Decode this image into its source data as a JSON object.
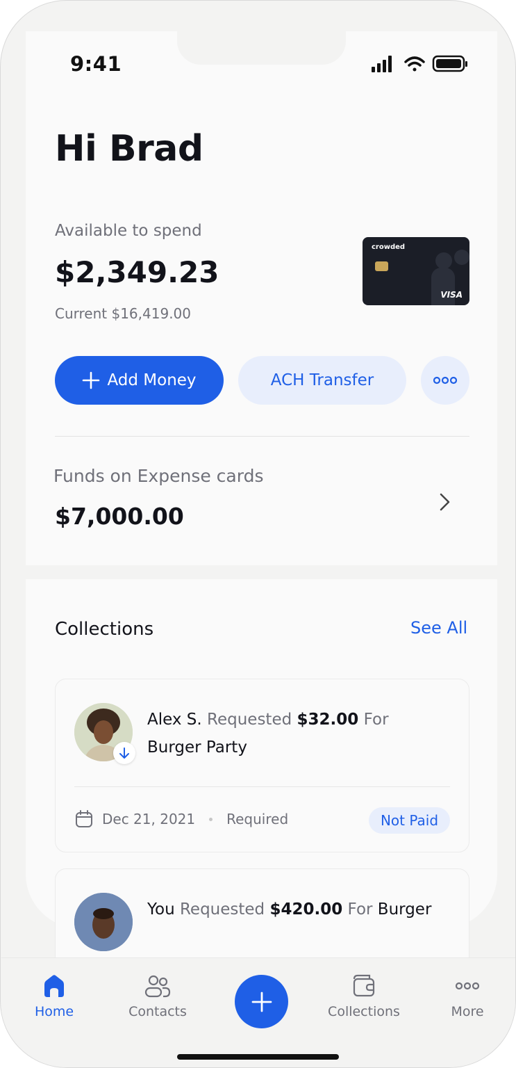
{
  "status": {
    "time": "9:41"
  },
  "greeting": "Hi Brad",
  "balance": {
    "available_label": "Available to spend",
    "available_amount": "$2,349.23",
    "current_label": "Current",
    "current_amount": "$16,419.00"
  },
  "card": {
    "brand_logo": "crowded",
    "network": "VISA"
  },
  "actions": {
    "add_money": "Add Money",
    "ach_transfer": "ACH Transfer",
    "more_icon": "ellipsis-icon"
  },
  "funds": {
    "label": "Funds on Expense cards",
    "amount": "$7,000.00"
  },
  "collections": {
    "title": "Collections",
    "see_all": "See All",
    "items": [
      {
        "name": "Alex S.",
        "verb": "Requested",
        "amount": "$32.00",
        "for_label": "For",
        "event": "Burger Party",
        "date": "Dec 21, 2021",
        "requirement": "Required",
        "status": "Not Paid"
      },
      {
        "name": "You",
        "verb": "Requested",
        "amount": "$420.00",
        "for_label": "For",
        "event": "Burger"
      }
    ]
  },
  "tabs": [
    {
      "label": "Home",
      "icon": "home-icon",
      "active": true
    },
    {
      "label": "Contacts",
      "icon": "contacts-icon",
      "active": false
    },
    {
      "label": "",
      "icon": "plus-icon",
      "active": false
    },
    {
      "label": "Collections",
      "icon": "wallet-icon",
      "active": false
    },
    {
      "label": "More",
      "icon": "ellipsis-icon",
      "active": false
    }
  ],
  "colors": {
    "accent": "#1f5fe6",
    "accent_soft": "#e8eefc",
    "text": "#12131a",
    "muted": "#6f7079"
  }
}
